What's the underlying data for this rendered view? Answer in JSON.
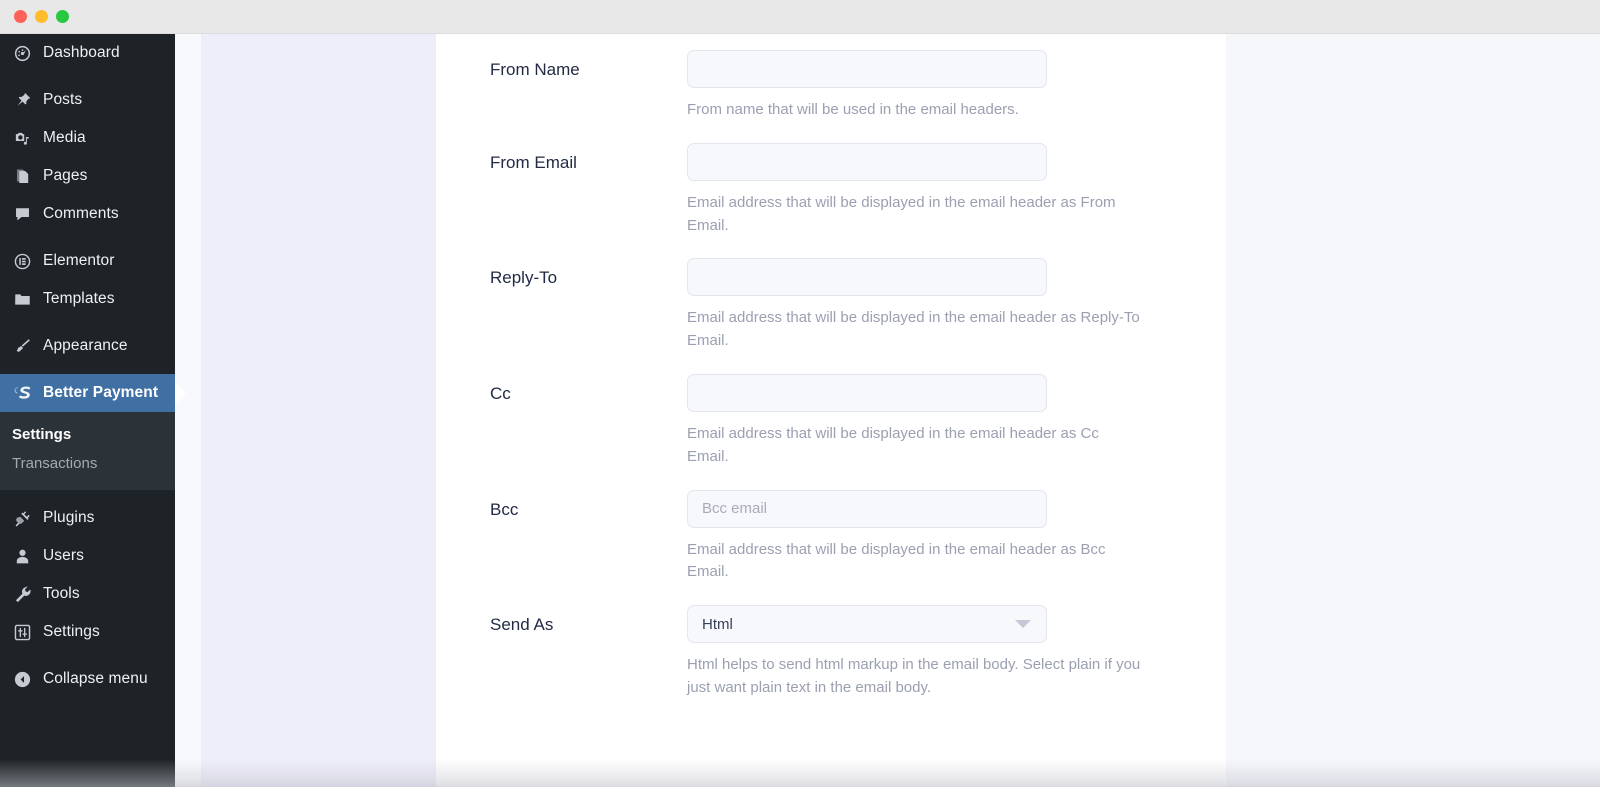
{
  "window": {
    "traffic_lights": [
      {
        "name": "close",
        "color": "#ff6159"
      },
      {
        "name": "minimize",
        "color": "#ffbd2e"
      },
      {
        "name": "zoom",
        "color": "#28c840"
      }
    ]
  },
  "sidebar": {
    "accent_color": "#3f6fa3",
    "background_color": "#1d2327",
    "submenu_background_color": "#2c3338",
    "groups": [
      {
        "items": [
          {
            "label": "Dashboard",
            "icon": "dashboard-gauge-icon",
            "active": false
          }
        ]
      },
      {
        "items": [
          {
            "label": "Posts",
            "icon": "pushpin-icon",
            "active": false
          },
          {
            "label": "Media",
            "icon": "media-camera-music-icon",
            "active": false
          },
          {
            "label": "Pages",
            "icon": "pages-stack-icon",
            "active": false
          },
          {
            "label": "Comments",
            "icon": "comment-bubble-icon",
            "active": false
          }
        ]
      },
      {
        "items": [
          {
            "label": "Elementor",
            "icon": "elementor-circle-icon",
            "active": false
          },
          {
            "label": "Templates",
            "icon": "folder-icon",
            "active": false
          }
        ]
      },
      {
        "items": [
          {
            "label": "Appearance",
            "icon": "paintbrush-icon",
            "active": false
          }
        ]
      },
      {
        "items": [
          {
            "label": "Better Payment",
            "icon": "better-payment-icon",
            "active": true
          }
        ]
      },
      {
        "items": [
          {
            "label": "Plugins",
            "icon": "plug-icon",
            "active": false
          },
          {
            "label": "Users",
            "icon": "user-icon",
            "active": false
          },
          {
            "label": "Tools",
            "icon": "wrench-icon",
            "active": false
          },
          {
            "label": "Settings",
            "icon": "sliders-icon",
            "active": false
          }
        ]
      },
      {
        "items": [
          {
            "label": "Collapse menu",
            "icon": "collapse-arrow-icon",
            "active": false
          }
        ]
      }
    ],
    "submenu": [
      {
        "label": "Settings",
        "current": true
      },
      {
        "label": "Transactions",
        "current": false
      }
    ]
  },
  "main": {
    "fields": [
      {
        "label": "From Name",
        "control": "text",
        "value": "",
        "placeholder": "",
        "help": "From name that will be used in the email headers."
      },
      {
        "label": "From Email",
        "control": "text",
        "value": "",
        "placeholder": "",
        "help": "Email address that will be displayed in the email header as From Email."
      },
      {
        "label": "Reply-To",
        "control": "text",
        "value": "",
        "placeholder": "",
        "help": "Email address that will be displayed in the email header as Reply-To Email."
      },
      {
        "label": "Cc",
        "control": "text",
        "value": "",
        "placeholder": "",
        "help": "Email address that will be displayed in the email header as Cc Email."
      },
      {
        "label": "Bcc",
        "control": "text",
        "value": "",
        "placeholder": "Bcc email",
        "help": "Email address that will be displayed in the email header as Bcc Email."
      },
      {
        "label": "Send As",
        "control": "select",
        "value": "Html",
        "placeholder": "",
        "help": "Html helps to send html markup in the email body. Select plain if you just want plain text in the email body."
      }
    ]
  }
}
